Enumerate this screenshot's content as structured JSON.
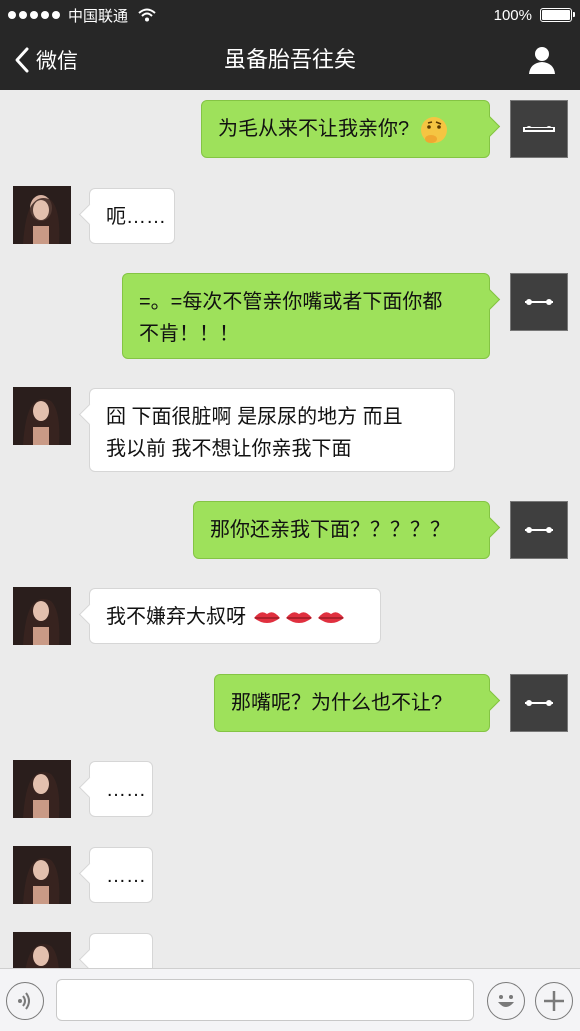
{
  "status_bar": {
    "carrier": "中国联通",
    "battery": "100%"
  },
  "nav": {
    "back_label": "微信",
    "title": "虽备胎吾往矣"
  },
  "messages": [
    {
      "side": "out",
      "text": "为毛从来不让我亲你?",
      "emoji": "thinking-face-icon"
    },
    {
      "side": "in",
      "text": "呃……"
    },
    {
      "side": "out",
      "line1": "=。=每次不管亲你嘴或者下面你都",
      "line2": "不肯！！！"
    },
    {
      "side": "in",
      "line1": "囧 下面很脏啊 是尿尿的地方 而且",
      "line2": "我以前 我不想让你亲我下面"
    },
    {
      "side": "out",
      "text": "那你还亲我下面？？？？？"
    },
    {
      "side": "in",
      "text": "我不嫌弃大叔呀",
      "emoji": "lips-icon"
    },
    {
      "side": "out",
      "text": "那嘴呢？为什么也不让?"
    },
    {
      "side": "in",
      "text": "……"
    },
    {
      "side": "in",
      "text": "……"
    },
    {
      "side": "in",
      "text": ""
    }
  ],
  "input": {
    "value": "",
    "placeholder": ""
  },
  "colors": {
    "bar": "#272727",
    "background": "#ebebeb",
    "bubble_out": "#9ee15b",
    "bubble_in": "#ffffff"
  }
}
